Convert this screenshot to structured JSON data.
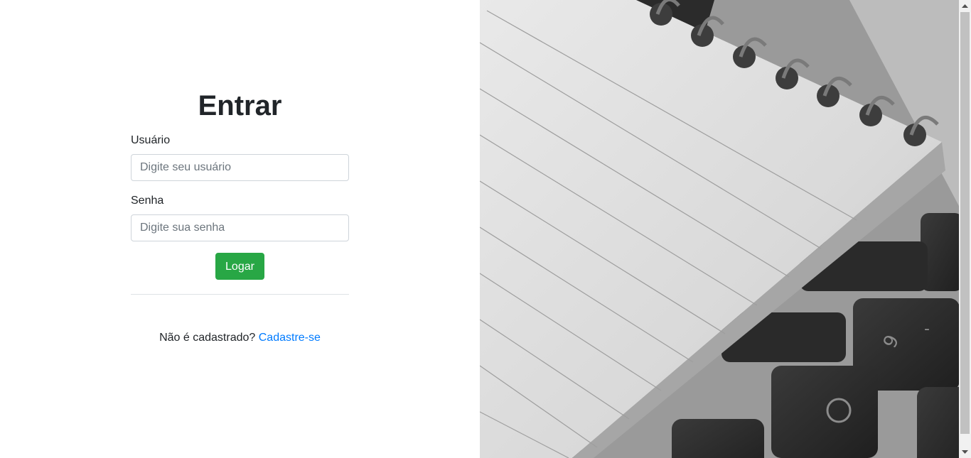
{
  "login": {
    "title": "Entrar",
    "username_label": "Usuário",
    "username_placeholder": "Digite seu usuário",
    "username_value": "",
    "password_label": "Senha",
    "password_placeholder": "Digite sua senha",
    "password_value": "",
    "submit_label": "Logar",
    "signup_prompt": "Não é cadastrado?",
    "signup_link": "Cadastre-se"
  },
  "hero": {
    "description": "grayscale photo of spiral notebook on laptop keyboard"
  },
  "colors": {
    "primary_button": "#28a745",
    "link": "#007bff",
    "border": "#ced4da"
  },
  "icons": {
    "scroll_up": "triangle-up",
    "scroll_down": "triangle-down"
  }
}
